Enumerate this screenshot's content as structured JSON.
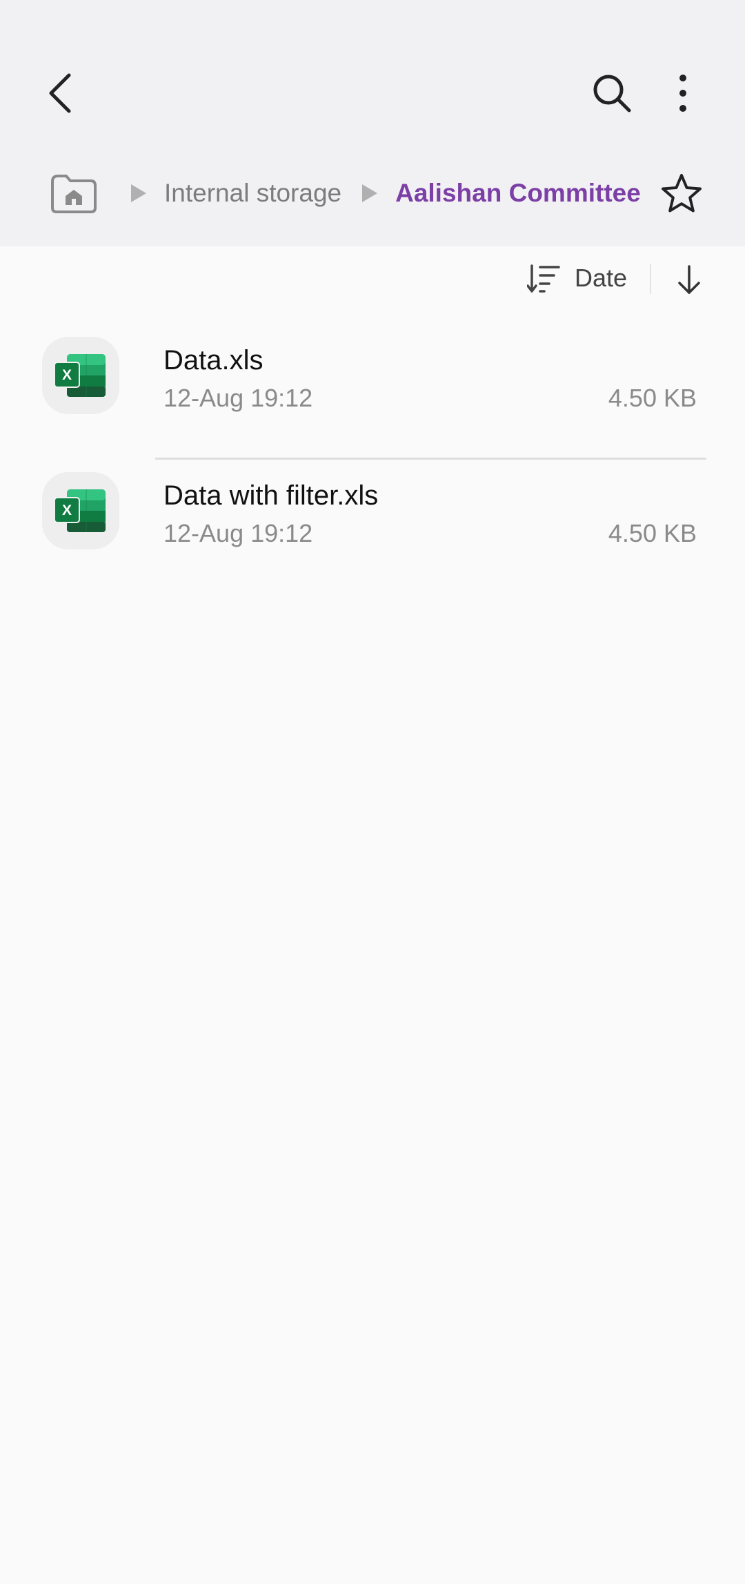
{
  "header": {
    "back_icon": "chevron-left-icon",
    "search_icon": "search-icon",
    "more_icon": "more-vertical-icon"
  },
  "breadcrumb": {
    "home_icon": "home-folder-icon",
    "items": [
      {
        "label": "Internal storage"
      },
      {
        "label": "Aalishan Committee"
      }
    ],
    "current_color": "#7b3fa6",
    "favorite_icon": "star-outline-icon"
  },
  "sort": {
    "label": "Date",
    "sort_icon": "sort-icon",
    "direction_icon": "arrow-down-icon"
  },
  "files": [
    {
      "name": "Data.xls",
      "date": "12-Aug 19:12",
      "size": "4.50 KB",
      "icon": "excel-icon"
    },
    {
      "name": "Data with filter.xls",
      "date": "12-Aug 19:12",
      "size": "4.50 KB",
      "icon": "excel-icon"
    }
  ]
}
